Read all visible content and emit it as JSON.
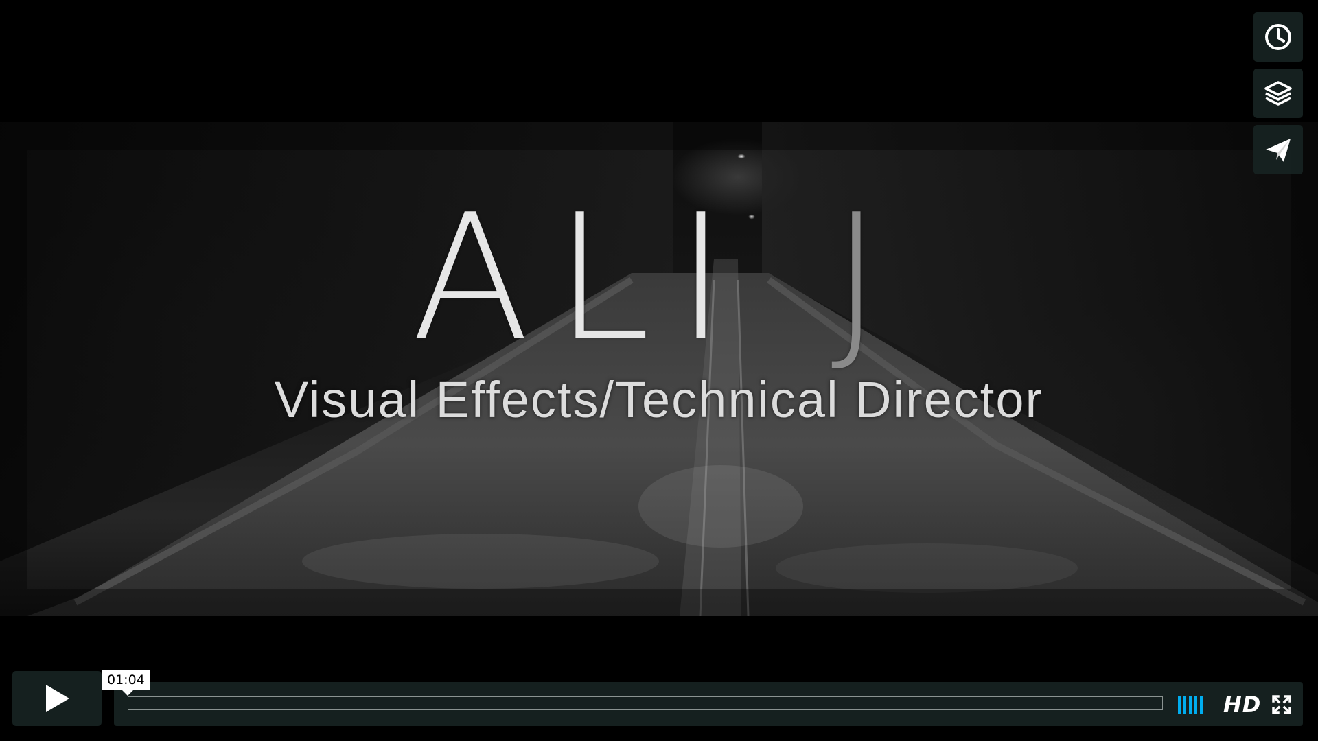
{
  "video": {
    "title_main": "ALI",
    "title_faded": "J",
    "subtitle": "Visual Effects/Technical Director"
  },
  "side_actions": [
    {
      "name": "watch-later",
      "icon": "clock-icon"
    },
    {
      "name": "collections",
      "icon": "layers-icon"
    },
    {
      "name": "share",
      "icon": "paper-plane-icon"
    }
  ],
  "controls": {
    "play_icon": "play-icon",
    "time_tooltip": "01:04",
    "progress_fraction": 0.0,
    "volume_bars": 5,
    "hd_label": "HD",
    "fullscreen_icon": "fullscreen-icon",
    "accent_color": "#00adef",
    "panel_color": "#172322"
  }
}
